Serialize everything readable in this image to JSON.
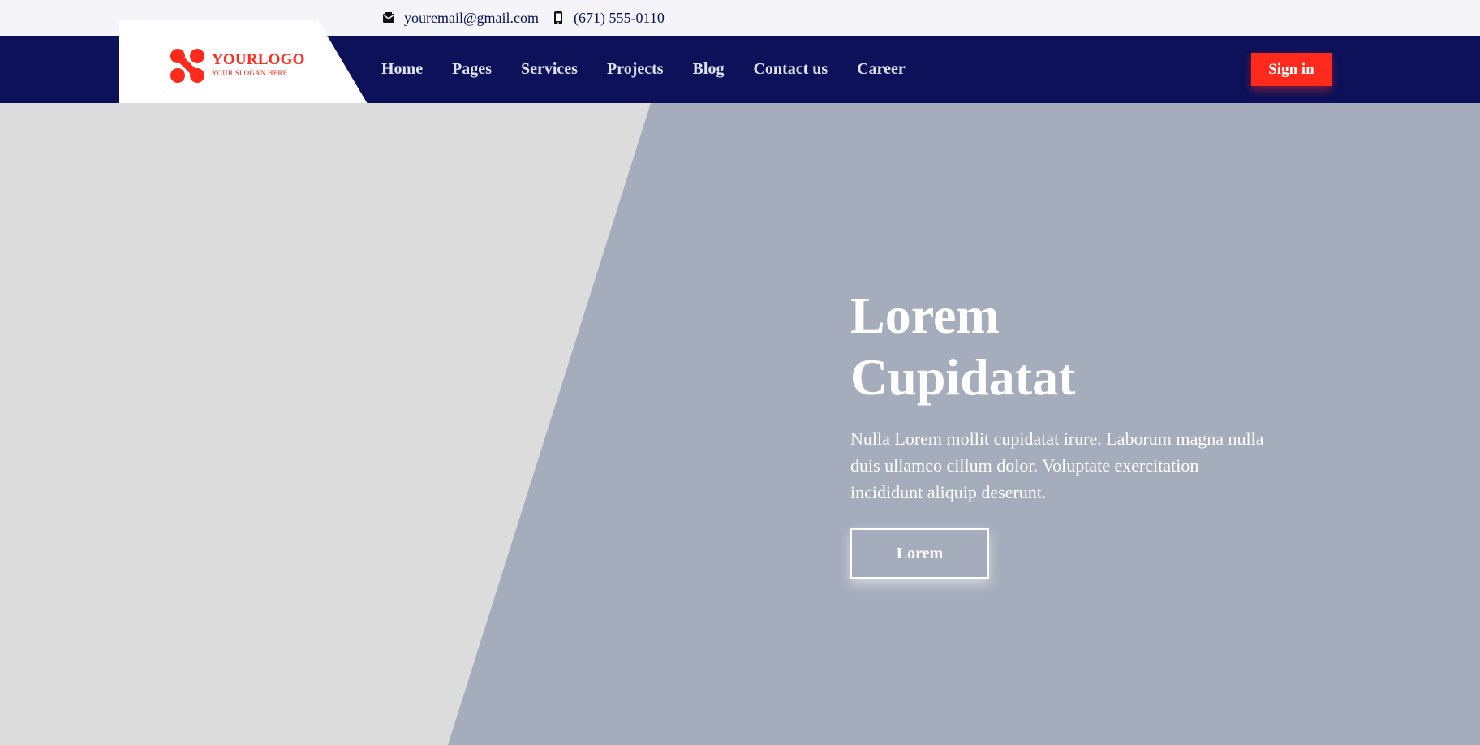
{
  "topbar": {
    "email": "youremail@gmail.com",
    "email_icon": "envelope-icon",
    "phone": "(671) 555-0110",
    "phone_icon": "mobile-phone-icon"
  },
  "logo": {
    "title": "YOURLOGO",
    "slogan": "YOUR SLOGAN HERE",
    "icon": "logo-mark-icon"
  },
  "nav": {
    "items": [
      {
        "label": "Home"
      },
      {
        "label": "Pages"
      },
      {
        "label": "Services"
      },
      {
        "label": "Projects"
      },
      {
        "label": "Blog"
      },
      {
        "label": "Contact us"
      },
      {
        "label": "Career"
      }
    ],
    "signin_label": "Sign in"
  },
  "hero": {
    "title_line1": "Lorem",
    "title_line2": "Cupidatat",
    "text": "Nulla Lorem mollit cupidatat irure. Laborum magna nulla duis ullamco cillum dolor. Voluptate exercitation incididunt aliquip deserunt.",
    "button_label": "Lorem"
  },
  "colors": {
    "navy": "#0c1159",
    "accent_red": "#ff2a1c",
    "hero_panel": "#a5acbb",
    "hero_bg": "#dcdcdc",
    "topbar_bg": "#f4f4f9"
  }
}
